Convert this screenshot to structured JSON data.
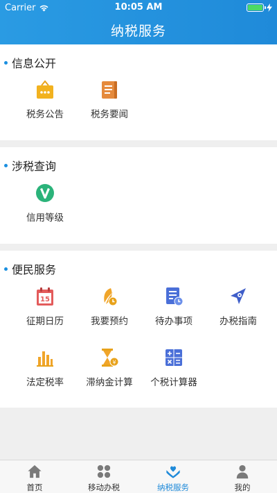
{
  "status_bar": {
    "carrier": "Carrier",
    "time": "10:05 AM"
  },
  "nav": {
    "title": "纳税服务"
  },
  "sections": {
    "info": {
      "title": "信息公开",
      "items": [
        {
          "label": "税务公告",
          "icon": "notice-icon"
        },
        {
          "label": "税务要闻",
          "icon": "news-book-icon"
        }
      ]
    },
    "query": {
      "title": "涉税查询",
      "items": [
        {
          "label": "信用等级",
          "icon": "credit-v-icon"
        }
      ]
    },
    "service": {
      "title": "便民服务",
      "items": [
        {
          "label": "征期日历",
          "icon": "calendar-icon"
        },
        {
          "label": "我要预约",
          "icon": "appointment-quill-icon"
        },
        {
          "label": "待办事项",
          "icon": "todo-doc-icon"
        },
        {
          "label": "办税指南",
          "icon": "guide-compass-icon"
        },
        {
          "label": "法定税率",
          "icon": "bar-chart-icon"
        },
        {
          "label": "滞纳金计算",
          "icon": "hourglass-icon"
        },
        {
          "label": "个税计算器",
          "icon": "calculator-icon"
        }
      ]
    }
  },
  "tabbar": {
    "items": [
      {
        "label": "首页"
      },
      {
        "label": "移动办税"
      },
      {
        "label": "纳税服务"
      },
      {
        "label": "我的"
      }
    ],
    "active": "纳税服务"
  },
  "colors": {
    "header": "#1f8ad9",
    "accent_dot": "#1a8fe0",
    "icon_gold": "#e8a21a",
    "icon_orange": "#e58a3c",
    "icon_green": "#2bb37a",
    "icon_red": "#e35b5b",
    "icon_blue": "#4a6fd8"
  }
}
